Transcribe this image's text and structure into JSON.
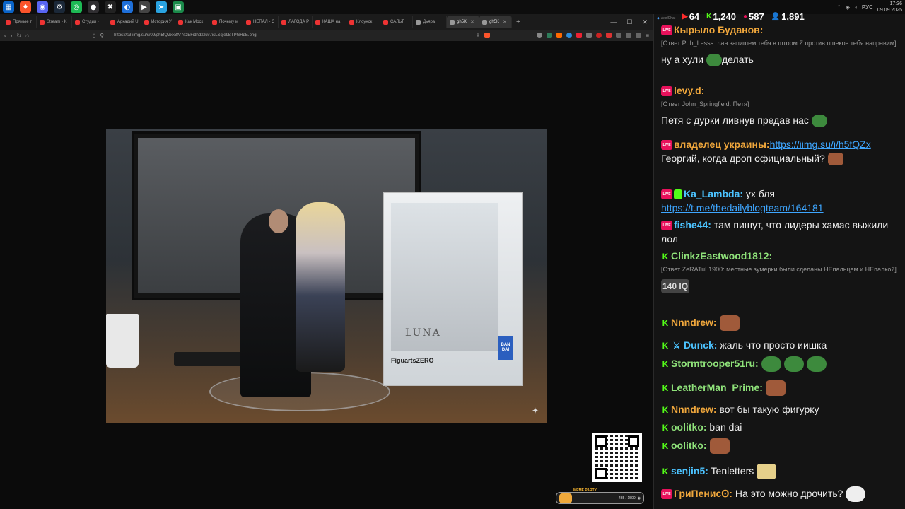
{
  "taskbar": {
    "icons": [
      "windows-icon",
      "brave-icon",
      "discord-icon",
      "steam-icon",
      "spotify-icon",
      "obs-icon",
      "capcut-icon",
      "app-icon",
      "player-icon",
      "telegram-icon",
      "screen-icon"
    ],
    "tray": {
      "lang": "РУС",
      "time": "17:36",
      "date": "09.09.2025"
    }
  },
  "browser": {
    "tabs": [
      {
        "label": "Прямые т"
      },
      {
        "label": "Stream - K"
      },
      {
        "label": "Студия -"
      },
      {
        "label": "Аркадий U"
      },
      {
        "label": "История У"
      },
      {
        "label": "Как Моск"
      },
      {
        "label": "Почему м"
      },
      {
        "label": "НЕПАЛ - С"
      },
      {
        "label": "ЛАГОДА Р"
      },
      {
        "label": "КАША на"
      },
      {
        "label": "Клоунск"
      },
      {
        "label": "САЛЬТ"
      },
      {
        "label": "Дьяра"
      },
      {
        "label": "gh5K"
      },
      {
        "label": "gh5K"
      }
    ],
    "new_tab": "+",
    "url": "https://s3.iimg.su/s/09/gh5fQZxx3fV7szEFidhdzzuv7isLSqle9BTPGRdE.png"
  },
  "photo": {
    "box_brand": "FiguartsZERO",
    "box_logo": "BAN DAI",
    "box_title": "LUNA",
    "sparkle": "✦"
  },
  "widget": {
    "title": "MEME PARTY",
    "progress": "435 / 1500"
  },
  "chat": {
    "header": "AxelChat",
    "stats": [
      {
        "icon": "youtube-icon",
        "value": "64",
        "color": "#ff2b2b"
      },
      {
        "icon": "kick-icon",
        "value": "1,240",
        "color": "#53fc18"
      },
      {
        "icon": "vk-live-icon",
        "value": "587",
        "color": "#e8115b"
      },
      {
        "icon": "viewers-icon",
        "value": "1,891",
        "color": "#4aa3ff"
      }
    ],
    "messages": [
      {
        "user": "Кырыло Буданов:",
        "color": "#f0a73c",
        "reply": "[Ответ Puh_Lesss: лан запишем тебя в шторм Z против пшеков тебя направим]",
        "text": "ну а хули",
        "text2": "делать"
      },
      {
        "user": "levy.d:",
        "color": "#f0a73c",
        "reply": "[Ответ John_Springfield: Петя]",
        "text": "Петя с дурки ливнув предав нас"
      },
      {
        "user": "владелец украины:",
        "color": "#f0a73c",
        "link": "https://iimg.su/i/h5fQZx",
        "text": " Георгий, когда дроп официальный?"
      },
      {
        "user": "Ka_Lambda:",
        "color": "#4cc3ff",
        "text": " ух бля",
        "link": "https://t.me/thedailyblogteam/164181"
      },
      {
        "user": "fishe44:",
        "color": "#4cc3ff",
        "text": " там пишут, что лидеры хамас выжили лол"
      },
      {
        "user": "ClinkzEastwood1812:",
        "color": "#8fe27a",
        "reply": "[Ответ ZeRATuL1900: местные зумерки были сделаны НЕпальцем и НЕпалкой]",
        "emote": "140 IQ"
      },
      {
        "user": "Nnndrew:",
        "color": "#f0a73c"
      },
      {
        "user": "Dunck:",
        "color": "#4cc3ff",
        "text": " жаль что просто иишка"
      },
      {
        "user": "Stormtrooper51ru:",
        "color": "#8fe27a"
      },
      {
        "user": "LeatherMan_Prime:",
        "color": "#8fe27a"
      },
      {
        "user": "Nnndrew:",
        "color": "#f0a73c",
        "text": " вот бы такую фигурку"
      },
      {
        "user": "oolitko:",
        "color": "#8fe27a",
        "text": " ban dai"
      },
      {
        "user": "oolitko:",
        "color": "#8fe27a"
      },
      {
        "user": "senjin5:",
        "color": "#4cc3ff",
        "text": " Tenletters"
      },
      {
        "user": "ГриПенисꙨ:",
        "color": "#f0a73c",
        "text": " На это можно дрочить?"
      }
    ]
  }
}
